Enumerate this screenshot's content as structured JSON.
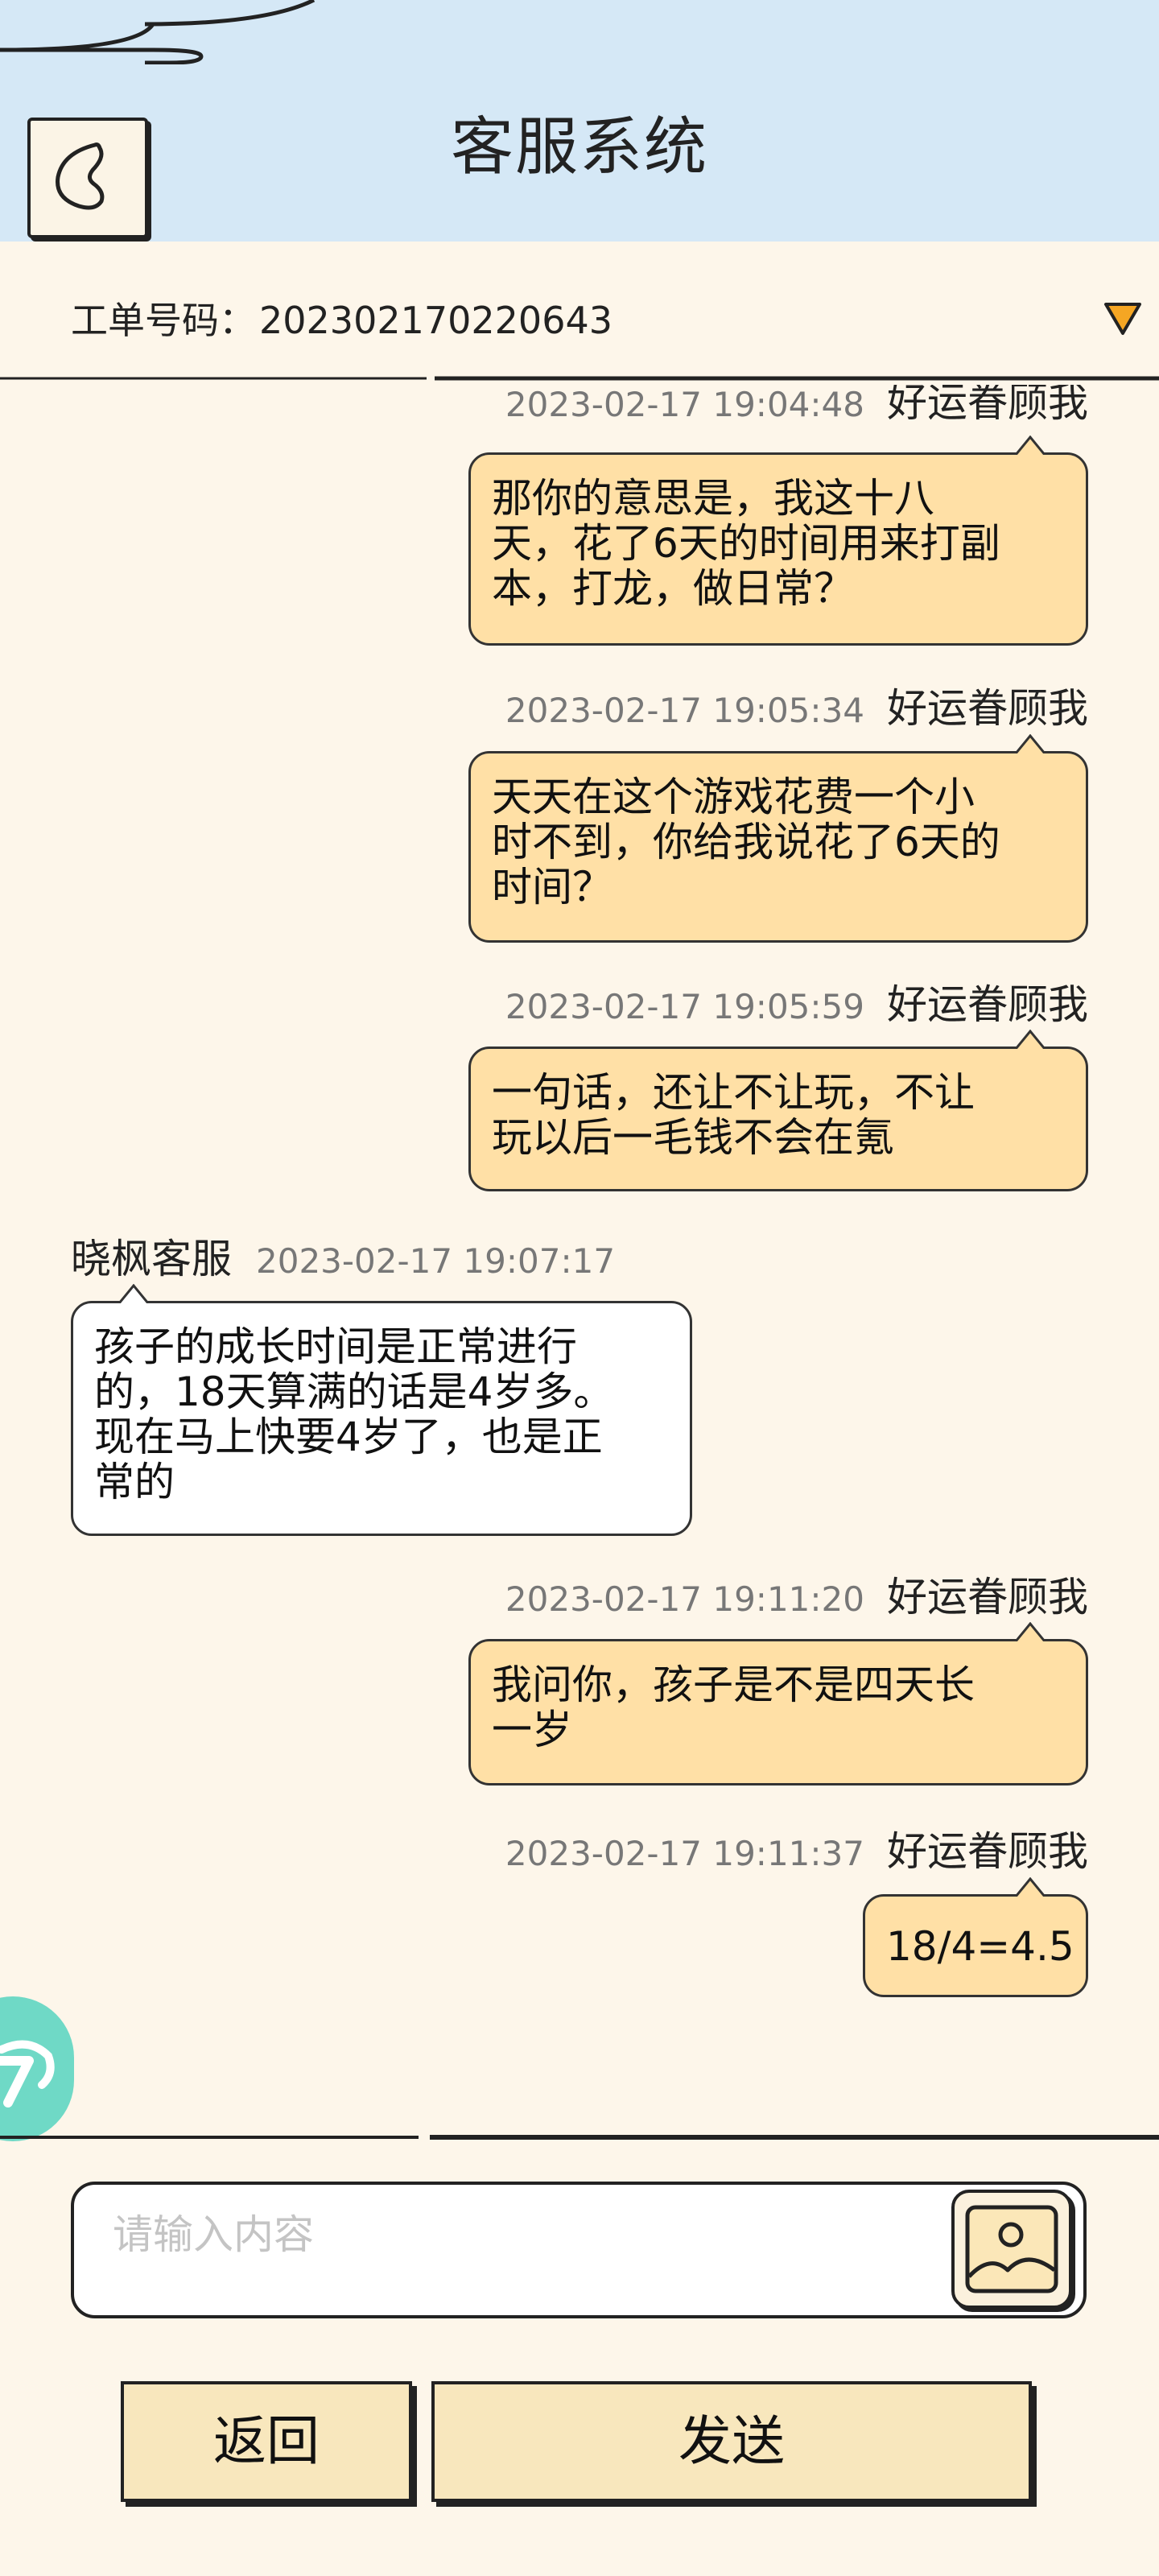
{
  "header": {
    "title": "客服系统",
    "back_icon": "back-chevron-icon"
  },
  "ticket": {
    "label": "工单号码：",
    "number": "202302170220643",
    "toggle_icon": "triangle-down-icon",
    "toggle_color": "#f5a623"
  },
  "messages": [
    {
      "side": "me",
      "time": "2023-02-17 19:04:48",
      "name": "好运眷顾我",
      "lines": [
        "那你的意思是，我这十八",
        "天，花了6天的时间用来打副",
        "本，打龙，做日常？"
      ]
    },
    {
      "side": "me",
      "time": "2023-02-17 19:05:34",
      "name": "好运眷顾我",
      "lines": [
        "天天在这个游戏花费一个小",
        "时不到，你给我说花了6天的",
        "时间？"
      ]
    },
    {
      "side": "me",
      "time": "2023-02-17 19:05:59",
      "name": "好运眷顾我",
      "lines": [
        "一句话，还让不让玩，不让",
        "玩以后一毛钱不会在氪"
      ]
    },
    {
      "side": "them",
      "time": "2023-02-17 19:07:17",
      "name": "晓枫客服",
      "lines": [
        "孩子的成长时间是正常进行",
        "的，18天算满的话是4岁多。",
        "现在马上快要4岁了，也是正",
        "常的"
      ]
    },
    {
      "side": "me",
      "time": "2023-02-17 19:11:20",
      "name": "好运眷顾我",
      "lines": [
        "我问你，孩子是不是四天长",
        "一岁"
      ]
    },
    {
      "side": "me",
      "time": "2023-02-17 19:11:37",
      "name": "好运眷顾我",
      "lines": [
        "18/4=4.5"
      ]
    }
  ],
  "input": {
    "placeholder": "请输入内容",
    "image_icon": "image-upload-icon"
  },
  "buttons": {
    "back_label": "返回",
    "send_label": "发送"
  },
  "floating": {
    "icon": "game-controller-icon"
  },
  "colors": {
    "header_bg": "#d5e8f6",
    "page_bg": "#fdf6ea",
    "my_bubble": "#ffe0a6",
    "their_bubble": "#ffffff",
    "button_bg": "#f8e7bd"
  }
}
